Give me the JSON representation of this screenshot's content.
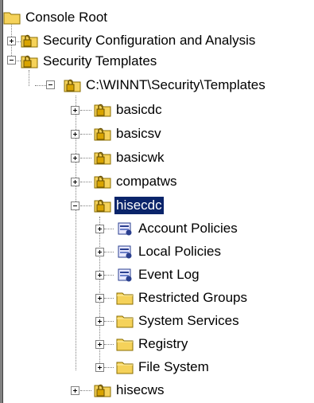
{
  "tree": {
    "root": {
      "label": "Console Root"
    },
    "security_config": {
      "label": "Security Configuration and Analysis"
    },
    "security_templates": {
      "label": "Security Templates"
    },
    "templates_path": {
      "label": "C:\\WINNT\\Security\\Templates"
    },
    "templates": [
      {
        "label": "basicdc"
      },
      {
        "label": "basicsv"
      },
      {
        "label": "basicwk"
      },
      {
        "label": "compatws"
      },
      {
        "label": "hisecdc",
        "selected": true
      },
      {
        "label": "hisecws"
      }
    ],
    "hisecdc_children": [
      {
        "label": "Account Policies",
        "icon": "policy-icon"
      },
      {
        "label": "Local Policies",
        "icon": "policy-icon"
      },
      {
        "label": "Event Log",
        "icon": "policy-icon"
      },
      {
        "label": "Restricted Groups",
        "icon": "folder-icon"
      },
      {
        "label": "System Services",
        "icon": "folder-icon"
      },
      {
        "label": "Registry",
        "icon": "folder-icon"
      },
      {
        "label": "File System",
        "icon": "folder-icon"
      }
    ]
  },
  "colors": {
    "selection": "#0a246a",
    "folder": "#f5d25a",
    "lock": "#d9a400"
  }
}
